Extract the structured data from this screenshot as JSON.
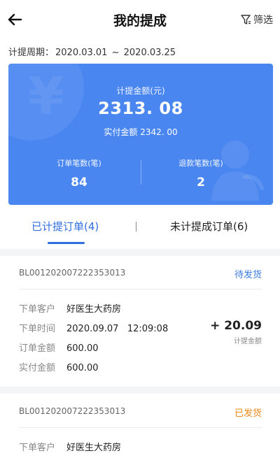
{
  "header": {
    "title": "我的提成",
    "filter_label": "筛选"
  },
  "period": {
    "label": "计提周期：",
    "start": "2020.03.01",
    "separator": "~",
    "end": "2020.03.25"
  },
  "summary": {
    "amount_label": "计提金额(元)",
    "amount_value": "2313. 08",
    "paid_label": "实付金额",
    "paid_value": "2342. 00",
    "orders_label": "订单笔数(笔)",
    "orders_value": "84",
    "refunds_label": "退款笔数(笔)",
    "refunds_value": "2",
    "color": "#4a86f0"
  },
  "tabs": [
    {
      "label": "已计提订单(4)",
      "active": true
    },
    {
      "label": "未计提成订单(6)",
      "active": false
    }
  ],
  "orders": [
    {
      "id": "BL001202007222353013",
      "status": "待发货",
      "status_color": "#3b79e0",
      "customer_label": "下单客户",
      "customer": "好医生大药房",
      "time_label": "下单时间",
      "time": "2020.09.07   12:09:08",
      "amount_label": "订单金额",
      "amount": "600.00",
      "paid_label": "实付金额",
      "paid": "600.00",
      "commission": "+ 20.09",
      "commission_label": "计提金额"
    },
    {
      "id": "BL001202007222353013",
      "status": "已发货",
      "status_color": "#f08a1c",
      "customer_label": "下单客户",
      "customer": "好医生大药房"
    }
  ],
  "icons": {
    "back": "arrow-left-icon",
    "filter": "filter-funnel-icon"
  }
}
